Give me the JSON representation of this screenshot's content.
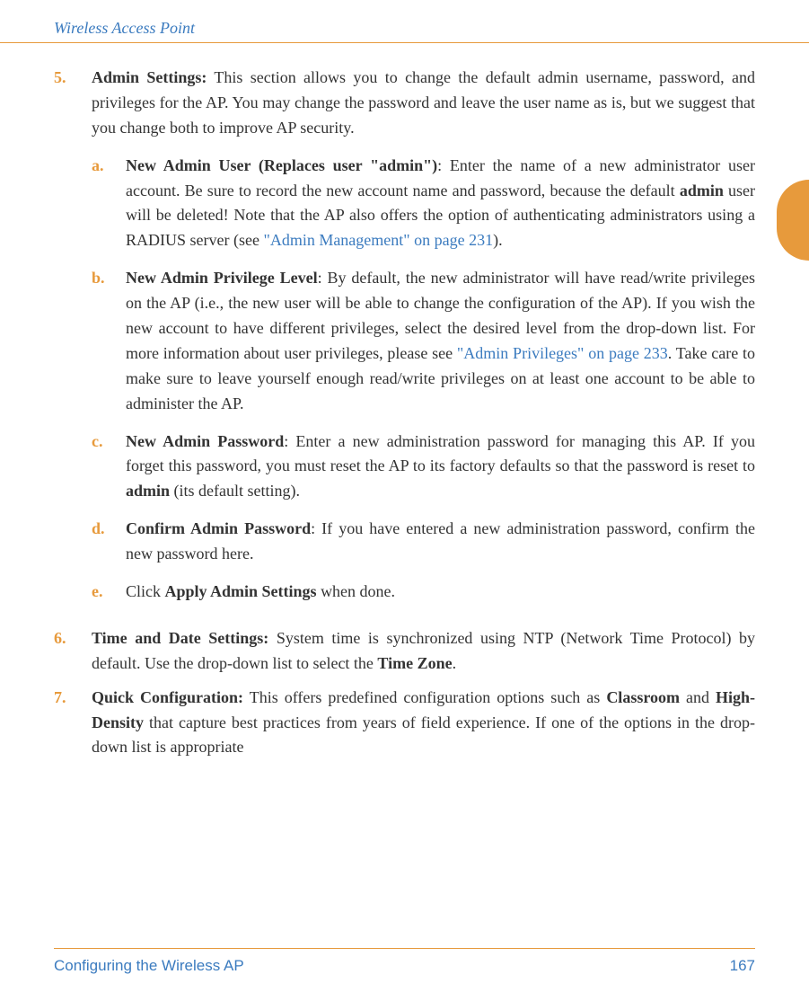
{
  "header": {
    "title": "Wireless Access Point"
  },
  "item5": {
    "num": "5.",
    "lead_bold": "Admin Settings:",
    "lead_rest": " This section allows you to change the default admin username, password, and privileges for the AP. You may change the password and leave the user name as is, but we suggest that you change both to improve AP security."
  },
  "sub": {
    "a": {
      "num": "a.",
      "bold": "New Admin User (Replaces user \"admin\")",
      "t1": ": Enter the name of a new administrator user account. Be sure to record the new account name and password, because the default ",
      "b2": "admin",
      "t2": " user will be deleted! Note that the AP also offers the option of authenticating administrators using a RADIUS server (see ",
      "link": "\"Admin Management\" on page 231",
      "t3": ")."
    },
    "b": {
      "num": "b.",
      "bold": "New Admin Privilege Level",
      "t1": ": By default, the new administrator will have read/write privileges on the AP (i.e., the new user will be able to change the configuration of the AP). If you wish the new account to have different privileges, select the desired level from the drop-down list. For more information about user privileges, please see ",
      "link": "\"Admin Privileges\" on page 233",
      "t2": ". Take care to make sure to leave yourself enough read/write privileges on at least one account to be able to administer the AP."
    },
    "c": {
      "num": "c.",
      "bold": "New Admin Password",
      "t1": ": Enter a new administration password for managing this AP. If you forget this password, you must reset the AP to its factory defaults so that the password is reset to ",
      "b2": "admin",
      "t2": " (its default setting)."
    },
    "d": {
      "num": "d.",
      "bold": "Confirm Admin Password",
      "t1": ": If you have entered a new administration password, confirm the new password here."
    },
    "e": {
      "num": "e.",
      "t1": "Click ",
      "bold": "Apply Admin Settings",
      "t2": " when done."
    }
  },
  "item6": {
    "num": "6.",
    "bold": "Time and Date Settings:",
    "t1": " System time is synchronized using NTP (Network Time Protocol) by default. Use the drop-down list to select the ",
    "b2": "Time Zone",
    "t2": "."
  },
  "item7": {
    "num": "7.",
    "bold": "Quick Configuration:",
    "t1": " This offers predefined configuration options such as ",
    "b2": "Classroom",
    "t2": " and ",
    "b3": "High-Density",
    "t3": " that capture best practices from years of field experience. If one of the options in the drop-down list is appropriate"
  },
  "footer": {
    "left": "Configuring the Wireless AP",
    "right": "167"
  }
}
